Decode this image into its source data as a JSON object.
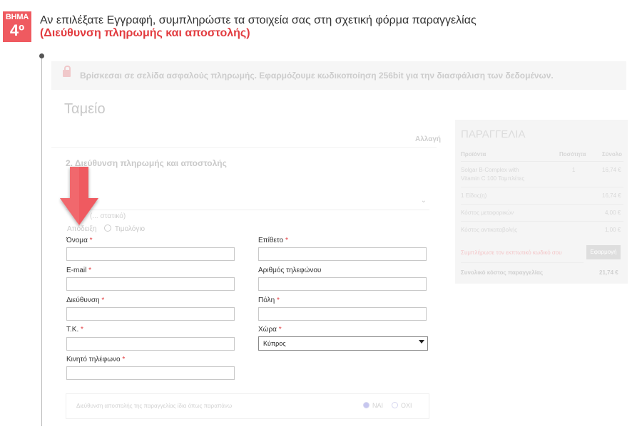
{
  "step": {
    "badge_word": "ΒΗΜΑ",
    "badge_number": "4º",
    "instruction": "Αν επιλέξατε Εγγραφή, συμπληρώστε τα στοιχεία σας στη σχετική φόρμα παραγγελίας",
    "highlight": "(Διεύθυνση πληρωμής και αποστολής)"
  },
  "checkout": {
    "secure_notice": "Βρίσκεσαι σε σελίδα ασφαλούς πληρωμής. Εφαρμόζουμε κωδικοποίηση 256bit για την διασφάλιση των δεδομένων.",
    "title": "Ταμείο",
    "other_link": "Αλλαγή",
    "section_title": "2. Διεύθυνση πληρωμής και αποστολής",
    "address_type_label": "(... στατικό)",
    "radio_receipt": "Απόδειξη",
    "radio_invoice": "Τιμολόγιο"
  },
  "form": {
    "first_name": "Όνομα",
    "last_name": "Επίθετο",
    "email": "E-mail",
    "phone": "Αριθμός τηλεφώνου",
    "address": "Διεύθυνση",
    "city": "Πόλη",
    "postcode": "Τ.Κ.",
    "country": "Χώρα",
    "country_value": "Κύπρος",
    "mobile": "Κινητό τηλέφωνο",
    "required_mark": "*"
  },
  "shipping": {
    "question": "Διεύθυνση αποστολής της παραγγελίας ίδια όπως παραπάνω",
    "yes": "ΝΑΙ",
    "no": "ΟΧΙ"
  },
  "order": {
    "title": "ΠΑΡΑΓΓΕΛΙΑ",
    "col_product": "Προϊόντα",
    "col_qty": "Ποσότητα",
    "col_total": "Σύνολο",
    "item_name_1": "Solgar B-Complex with",
    "item_name_2": "Vitamin C 100 Ταμπλέτες",
    "item_qty": "1",
    "item_price": "16,74 €",
    "items_count": "1 Είδος(η)",
    "items_total": "16,74 €",
    "shipping_label": "Κόστος μεταφορικών",
    "shipping_cost": "4,00 €",
    "cod_label": "Κόστος αντικαταβολής",
    "cod_cost": "1,00 €",
    "coupon_placeholder": "Συμπλήρωσε τον εκπτωτικό κωδικό σου",
    "apply": "Εφαρμογή",
    "total_label": "Συνολικό κόστος παραγγελίας",
    "total_value": "21,74 €"
  },
  "colors": {
    "accent": "#ef5a60",
    "highlight_text": "#e23b3f"
  },
  "icons": [
    "lock-icon",
    "arrow-down-icon",
    "chevron-down-icon"
  ]
}
